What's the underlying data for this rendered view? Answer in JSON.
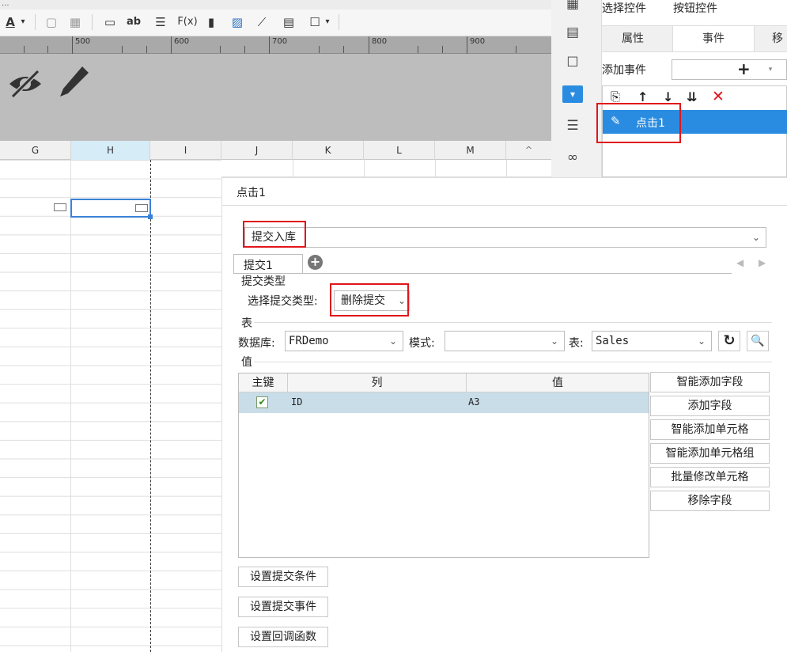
{
  "toolbar": {
    "partial_label": "...",
    "items": [
      "A",
      "ab",
      "F(x)"
    ]
  },
  "ruler": {
    "labels": [
      "500",
      "600",
      "700",
      "800",
      "900"
    ]
  },
  "sheet": {
    "columns": [
      "G",
      "H",
      "I",
      "J",
      "K",
      "L",
      "M"
    ],
    "selected_column": "H"
  },
  "right_panel": {
    "select_widget_label": "选择控件",
    "select_widget_value": "按钮控件",
    "tabs": [
      "属性",
      "事件",
      "移"
    ],
    "active_tab": "事件",
    "add_event_label": "添加事件",
    "add_event_button": "+",
    "event_items": [
      "点击1"
    ]
  },
  "dialog": {
    "title": "点击1",
    "action_type": "提交入库",
    "submit_tab": "提交1",
    "submit_type_section": "提交类型",
    "submit_type_label": "选择提交类型:",
    "submit_type_value": "删除提交",
    "table_section": "表",
    "database_label": "数据库:",
    "database_value": "FRDemo",
    "schema_label": "模式:",
    "schema_value": "",
    "table_label": "表:",
    "table_value": "Sales",
    "value_section": "值",
    "field_table": {
      "headers": [
        "主键",
        "列",
        "值"
      ],
      "rows": [
        {
          "primary_key": true,
          "column": "ID",
          "value": "A3"
        }
      ]
    },
    "side_buttons": [
      "智能添加字段",
      "添加字段",
      "智能添加单元格",
      "智能添加单元格组",
      "批量修改单元格",
      "移除字段"
    ],
    "bottom_buttons": [
      "设置提交条件",
      "设置提交事件",
      "设置回调函数"
    ]
  },
  "colors": {
    "accent_blue": "#2a8ce0",
    "highlight_red": "#e0161b",
    "selected_row": "#c9dde9"
  }
}
